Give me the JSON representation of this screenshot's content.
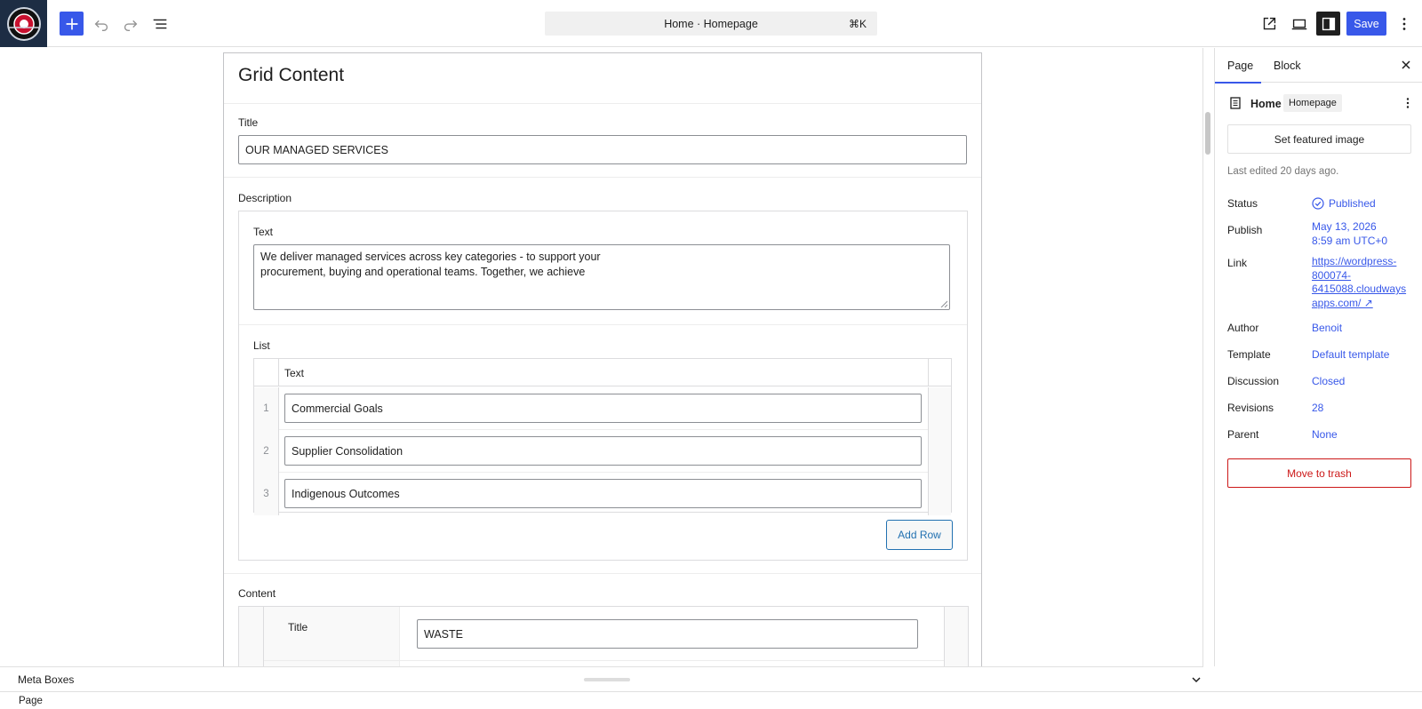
{
  "toolbar": {
    "command_center": "Home · Homepage",
    "shortcut": "⌘K",
    "save_label": "Save"
  },
  "colors": {
    "accent": "#3858e9",
    "danger": "#cc1818",
    "link": "#2271b1"
  },
  "metabox": {
    "heading": "Grid Content",
    "title_label": "Title",
    "title_value": "OUR MANAGED SERVICES",
    "description_label": "Description",
    "text_label": "Text",
    "text_value_line1": "We deliver managed services across key categories - to support your",
    "text_value_line2": "procurement, buying and operational teams. Together, we achieve",
    "list_label": "List",
    "list_column": "Text",
    "list_rows": [
      {
        "num": "1",
        "value": "Commercial Goals"
      },
      {
        "num": "2",
        "value": "Supplier Consolidation"
      },
      {
        "num": "3",
        "value": "Indigenous Outcomes"
      }
    ],
    "add_row_label": "Add Row",
    "content_label": "Content",
    "content_title_label": "Title",
    "content_title_value": "WASTE"
  },
  "sidebar": {
    "tab_page": "Page",
    "tab_block": "Block",
    "doc_title": "Home",
    "doc_badge": "Homepage",
    "featured_image": "Set featured image",
    "last_edited": "Last edited 20 days ago.",
    "rows": {
      "status_label": "Status",
      "status_value": "Published",
      "publish_label": "Publish",
      "publish_value_1": "May 13, 2026",
      "publish_value_2": "8:59 am UTC+0",
      "link_label": "Link",
      "link_1": "https://wordpress-",
      "link_2": "800074-",
      "link_3": "6415088.cloudways",
      "link_4": "apps.com/ ↗",
      "author_label": "Author",
      "author_value": "Benoit",
      "template_label": "Template",
      "template_value": "Default template",
      "discussion_label": "Discussion",
      "discussion_value": "Closed",
      "revisions_label": "Revisions",
      "revisions_value": "28",
      "parent_label": "Parent",
      "parent_value": "None"
    },
    "trash": "Move to trash"
  },
  "bottom": {
    "meta_boxes": "Meta Boxes",
    "footer": "Page"
  }
}
